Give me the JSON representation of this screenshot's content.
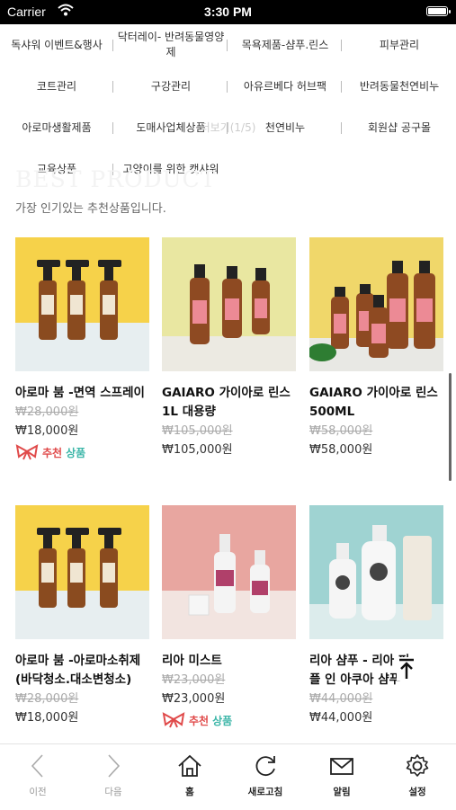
{
  "status_bar": {
    "carrier": "Carrier",
    "time": "3:30 PM"
  },
  "categories": [
    {
      "label": "독샤워 이벤트&행사"
    },
    {
      "label": "닥터레이- 반려동물영양제"
    },
    {
      "label": "목욕제품-샴푸.린스"
    },
    {
      "label": "피부관리"
    },
    {
      "label": "코트관리"
    },
    {
      "label": "구강관리"
    },
    {
      "label": "아유르베다 허브팩"
    },
    {
      "label": "반려동물천연비누"
    },
    {
      "label": "아로마생활제품"
    },
    {
      "label": "도매사업체상품"
    },
    {
      "label": "천연비누"
    },
    {
      "label": "회원샵 공구몰"
    },
    {
      "label": "교육상품"
    },
    {
      "label": "고양이를 위한 캣샤워"
    }
  ],
  "more_label": "더보기(1/5)",
  "section": {
    "title": "BEST PRODUCT",
    "subtitle": "가장 인기있는 추천상품입니다."
  },
  "badge": {
    "part1": "추천",
    "part2": "상품"
  },
  "products": [
    {
      "name": "아로마 붐 -면역 스프레이",
      "old_price": "₩28,000원",
      "price": "₩18,000원"
    },
    {
      "name": "GAIARO 가이아로 린스 1L 대용량",
      "old_price": "₩105,000원",
      "price": "₩105,000원"
    },
    {
      "name": "GAIARO 가이아로 린스 500ML",
      "old_price": "₩58,000원",
      "price": "₩58,000원"
    },
    {
      "name": "아로마 붐 -아로마소취제 (바닥청소.대소변청소)",
      "old_price": "₩28,000원",
      "price": "₩18,000원"
    },
    {
      "name": "리아 미스트",
      "old_price": "₩23,000원",
      "price": "₩23,000원"
    },
    {
      "name": "리아 샴푸 - 리아 퍼플 인 아쿠아 샴푸",
      "old_price": "₩44,000원",
      "price": "₩44,000원"
    }
  ],
  "tabbar": {
    "back": "이전",
    "forward": "다음",
    "home": "홈",
    "refresh": "새로고침",
    "notifications": "알림",
    "settings": "설정"
  }
}
